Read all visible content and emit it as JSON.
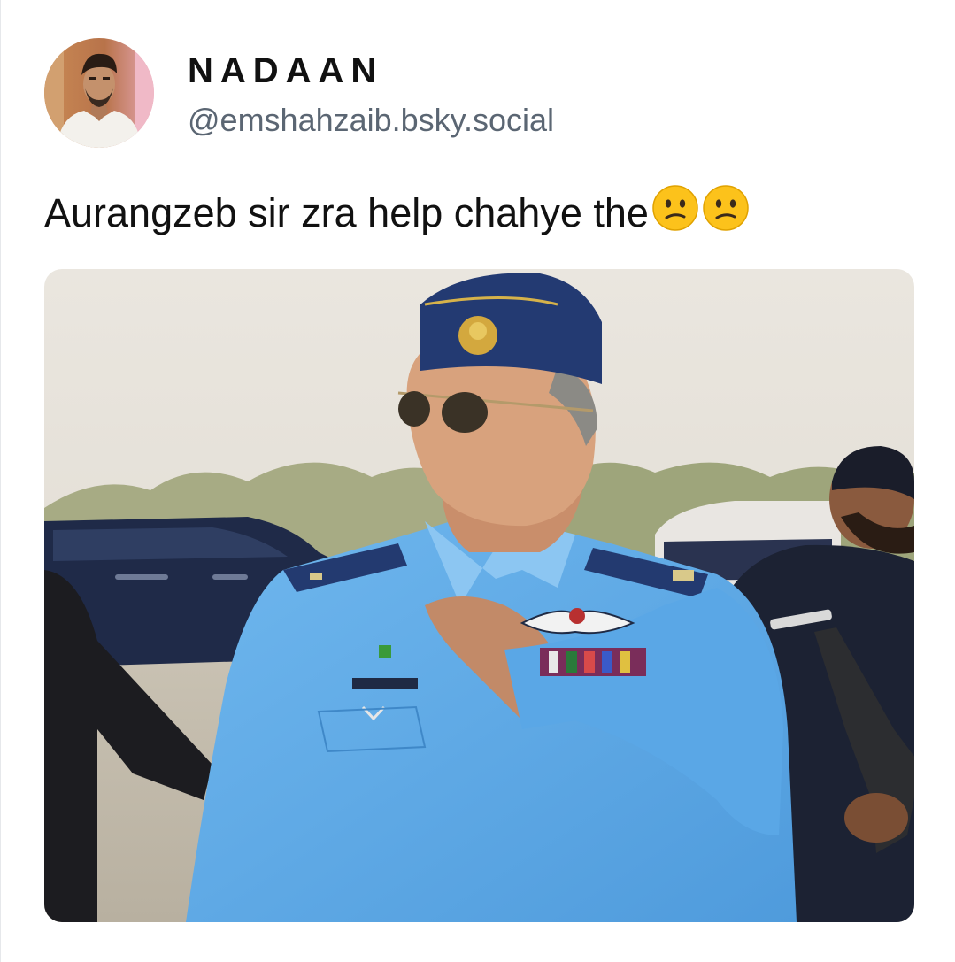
{
  "post": {
    "author": {
      "display_name": "NADAAN",
      "handle": "@emshahzaib.bsky.social",
      "avatar_icon": "user-avatar-photo"
    },
    "text": "Aurangzeb sir zra help chahye the",
    "emojis": [
      "confused-face-icon",
      "confused-face-icon"
    ],
    "media": {
      "type": "photo"
    }
  },
  "colors": {
    "text": "#111111",
    "handle": "#5b6673",
    "background": "#ffffff",
    "uniform_blue": "#63aee8",
    "cap_navy": "#223a76"
  }
}
